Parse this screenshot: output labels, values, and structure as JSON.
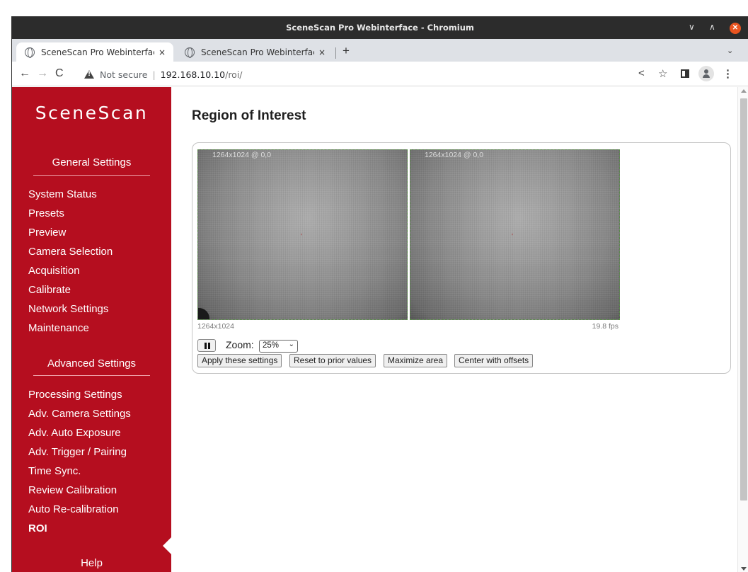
{
  "window": {
    "title": "SceneScan Pro Webinterface - Chromium",
    "controls": {
      "minimize": "∨",
      "maximize": "∧",
      "close": "✕"
    }
  },
  "tabs": [
    {
      "title": "SceneScan Pro Webinterface - Chromium",
      "short": "SceneScan Pro Webinterfac",
      "close": "×",
      "active": true
    },
    {
      "title": "SceneScan Pro Webinterface",
      "short": "SceneScan Pro Webinterfac",
      "close": "×",
      "active": false
    }
  ],
  "toolbar": {
    "new_tab": "+",
    "tab_list": "⌄",
    "back": "←",
    "forward": "→",
    "reload": "C",
    "security_label": "Not secure",
    "separator": "|",
    "url_host": "192.168.10.10",
    "url_path": "/roi/",
    "share": "<",
    "star": "☆",
    "menu": "⋮"
  },
  "sidebar": {
    "logo": "SceneScan",
    "general_heading": "General Settings",
    "general_items": [
      "System Status",
      "Presets",
      "Preview",
      "Camera Selection",
      "Acquisition",
      "Calibrate",
      "Network Settings",
      "Maintenance"
    ],
    "advanced_heading": "Advanced Settings",
    "advanced_items": [
      "Processing Settings",
      "Adv. Camera Settings",
      "Adv. Auto Exposure",
      "Adv. Trigger / Pairing",
      "Time Sync.",
      "Review Calibration",
      "Auto Re-calibration",
      "ROI"
    ],
    "active_item": "ROI",
    "help_heading": "Help"
  },
  "main": {
    "title": "Region of Interest",
    "cameras": [
      {
        "label": "1264x1024 @ 0,0",
        "marker": "'"
      },
      {
        "label": "1264x1024 @ 0,0",
        "marker": "'"
      }
    ],
    "resolution": "1264x1024",
    "fps": "19.8 fps",
    "zoom_label": "Zoom:",
    "zoom_value": "25%",
    "zoom_arrow": "⌄",
    "buttons": {
      "apply": "Apply these settings",
      "reset": "Reset to prior values",
      "maximize": "Maximize area",
      "center": "Center with offsets"
    }
  },
  "colors": {
    "sidebar_bg": "#b50e1f",
    "titlebar_bg": "#2c2c2c",
    "tabstrip_bg": "#dee1e6",
    "close_button": "#e95420"
  }
}
